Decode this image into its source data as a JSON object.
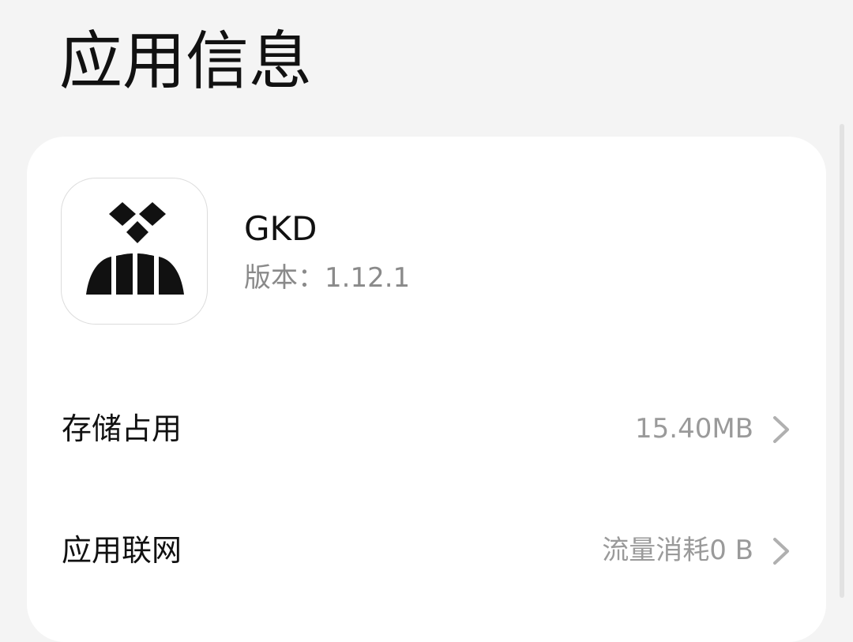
{
  "page": {
    "title": "应用信息"
  },
  "app": {
    "name": "GKD",
    "version": "版本：1.12.1",
    "icon": "gkd-app-icon"
  },
  "rows": [
    {
      "label": "存储占用",
      "value": "15.40MB",
      "icon": "chevron-right-icon"
    },
    {
      "label": "应用联网",
      "value": "流量消耗0 B",
      "icon": "chevron-right-icon"
    }
  ],
  "colors": {
    "background": "#f4f4f4",
    "card": "#ffffff",
    "primary_text": "#111111",
    "secondary_text": "#8a8a8a",
    "chevron": "#b0b0b0"
  }
}
